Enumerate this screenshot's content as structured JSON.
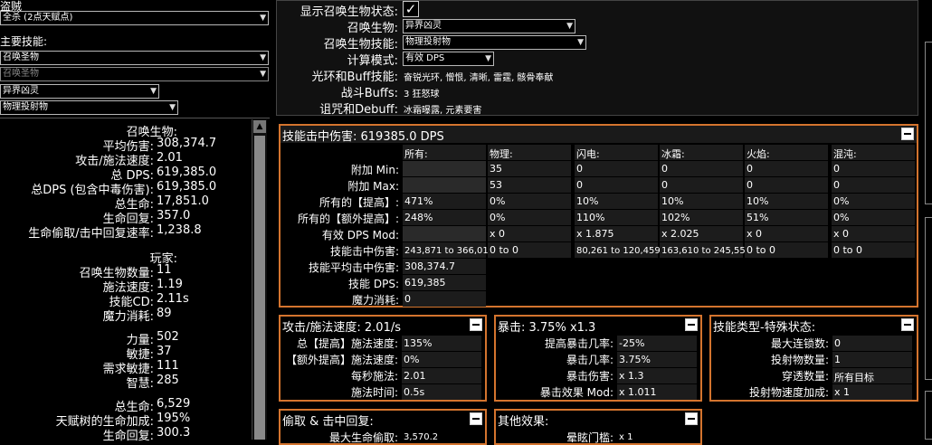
{
  "left": {
    "class_label": "盗贼",
    "ascendancy_select": "全杀 (2点天赋点)",
    "main_skill_label": "主要技能:",
    "main_skill_select": "召唤圣物",
    "sub_skill_select": "召唤圣物",
    "minion_select": "异界凶灵",
    "minion_skill_select": "物理投射物",
    "minion_header": "召唤生物:",
    "minion_stats": [
      {
        "k": "平均伤害:",
        "v": "308,374.7"
      },
      {
        "k": "攻击/施法速度:",
        "v": "2.01"
      },
      {
        "k": "总 DPS:",
        "v": "619,385.0"
      },
      {
        "k": "总DPS (包含中毒伤害):",
        "v": "619,385.0"
      },
      {
        "k": "总生命:",
        "v": "17,851.0"
      },
      {
        "k": "生命回复:",
        "v": "357.0"
      },
      {
        "k": "生命偷取/击中回复速率:",
        "v": "1,238.8"
      }
    ],
    "player_header": "玩家:",
    "player_stats": [
      {
        "k": "召唤生物数量:",
        "v": "11"
      },
      {
        "k": "施法速度:",
        "v": "1.19"
      },
      {
        "k": "技能CD:",
        "v": "2.11s"
      },
      {
        "k": "魔力消耗:",
        "v": "89"
      }
    ],
    "attr_stats": [
      {
        "k": "力量:",
        "v": "502"
      },
      {
        "k": "敏捷:",
        "v": "37"
      },
      {
        "k": "需求敏捷:",
        "v": "111"
      },
      {
        "k": "智慧:",
        "v": "285"
      }
    ],
    "life_stats": [
      {
        "k": "总生命:",
        "v": "6,529"
      },
      {
        "k": "天赋树的生命加成:",
        "v": "195%"
      },
      {
        "k": "生命回复:",
        "v": "300.3"
      }
    ]
  },
  "config": {
    "show_minion_stats_label": "显示召唤生物状态:",
    "show_minion_stats_check": "✓",
    "minion_label": "召唤生物:",
    "minion_value": "异界凶灵",
    "minion_skill_label": "召唤生物技能:",
    "minion_skill_value": "物理投射物",
    "calc_mode_label": "计算模式:",
    "calc_mode_value": "有效 DPS",
    "aura_label": "光环和Buff技能:",
    "aura_value": "奋锐光环, 憎恨, 清晰, 雷霆, 骸骨奉献",
    "combat_label": "战斗Buffs:",
    "combat_value": "3 狂怒球",
    "curse_label": "诅咒和Debuff:",
    "curse_value": "冰霜曝露, 元素要害"
  },
  "hit": {
    "title": "技能击中伤害: 619385.0 DPS",
    "columns": [
      "所有:",
      "物理:",
      "闪电:",
      "冰霜:",
      "火焰:",
      "混沌:"
    ],
    "rows": [
      {
        "label": "附加 Min:",
        "cells": [
          "",
          "35",
          "0",
          "0",
          "0",
          "0"
        ]
      },
      {
        "label": "附加 Max:",
        "cells": [
          "",
          "53",
          "0",
          "0",
          "0",
          "0"
        ]
      },
      {
        "label": "所有的【提高】:",
        "cells": [
          "471%",
          "0%",
          "10%",
          "10%",
          "10%",
          "0%"
        ]
      },
      {
        "label": "所有的【额外提高】:",
        "cells": [
          "248%",
          "0%",
          "110%",
          "102%",
          "51%",
          "0%"
        ]
      },
      {
        "label": "有效 DPS Mod:",
        "cells": [
          "",
          "x 0",
          "x 1.875",
          "x 2.025",
          "x 0",
          "x 0"
        ]
      },
      {
        "label": "技能击中伤害:",
        "cells": [
          "243,871 to 366,017",
          "0 to 0",
          "80,261 to 120,459",
          "163,610 to 245,558",
          "0 to 0",
          "0 to 0"
        ]
      }
    ],
    "tail": [
      {
        "label": "技能平均击中伤害:",
        "value": "308,374.7"
      },
      {
        "label": "技能 DPS:",
        "value": "619,385"
      },
      {
        "label": "魔力消耗:",
        "value": "0"
      }
    ]
  },
  "speed": {
    "title": "攻击/施法速度: 2.01/s",
    "rows": [
      {
        "k": "总【提高】施法速度:",
        "v": "135%"
      },
      {
        "k": "【额外提高】施法速度:",
        "v": "0%"
      },
      {
        "k": "每秒施法:",
        "v": "2.01"
      },
      {
        "k": "施法时间:",
        "v": "0.5s"
      }
    ]
  },
  "crit": {
    "title": "暴击: 3.75% x1.3",
    "rows": [
      {
        "k": "提高暴击几率:",
        "v": "-25%"
      },
      {
        "k": "暴击几率:",
        "v": "3.75%"
      },
      {
        "k": "暴击伤害:",
        "v": "x 1.3"
      },
      {
        "k": "暴击效果 Mod:",
        "v": "x 1.011"
      }
    ]
  },
  "skilltype": {
    "title": "技能类型-特殊状态:",
    "rows": [
      {
        "k": "最大连锁数:",
        "v": "0"
      },
      {
        "k": "投射物数量:",
        "v": "1"
      },
      {
        "k": "穿透数量:",
        "v": "所有目标"
      },
      {
        "k": "投射物速度加成:",
        "v": "x 1"
      }
    ]
  },
  "leech": {
    "title": "偷取 & 击中回复:",
    "first_label": "最大生命偷取:",
    "first_value": "3,570.2"
  },
  "other": {
    "title": "其他效果:",
    "first_label": "晕眩门槛:",
    "first_value": "x 1"
  }
}
